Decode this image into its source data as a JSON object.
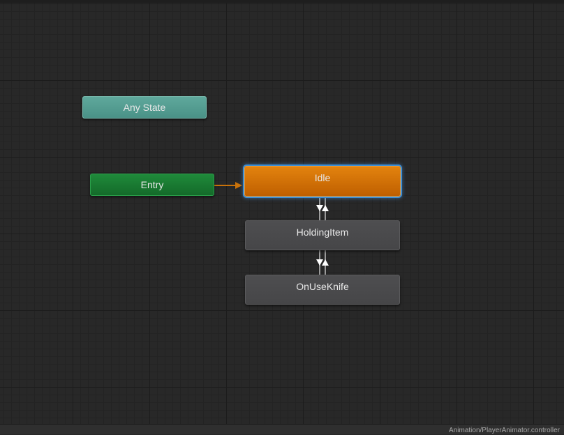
{
  "graph": {
    "nodes": {
      "any_state": {
        "label": "Any State",
        "color": "#5fa89c"
      },
      "entry": {
        "label": "Entry",
        "color": "#1f8a3a"
      },
      "idle": {
        "label": "Idle",
        "color": "#e3830e",
        "is_default": true,
        "selected": true
      },
      "holding_item": {
        "label": "HoldingItem",
        "color": "#4e4e50"
      },
      "on_use_knife": {
        "label": "OnUseKnife",
        "color": "#4e4e50"
      }
    },
    "transitions": [
      {
        "from": "Entry",
        "to": "Idle",
        "color": "#c8720a"
      },
      {
        "from": "Idle",
        "to": "HoldingItem",
        "color": "#9a9a9a"
      },
      {
        "from": "HoldingItem",
        "to": "Idle",
        "color": "#9a9a9a"
      },
      {
        "from": "HoldingItem",
        "to": "OnUseKnife",
        "color": "#9a9a9a"
      },
      {
        "from": "OnUseKnife",
        "to": "HoldingItem",
        "color": "#9a9a9a"
      }
    ]
  },
  "status_bar": {
    "asset_path": "Animation/PlayerAnimator.controller"
  }
}
